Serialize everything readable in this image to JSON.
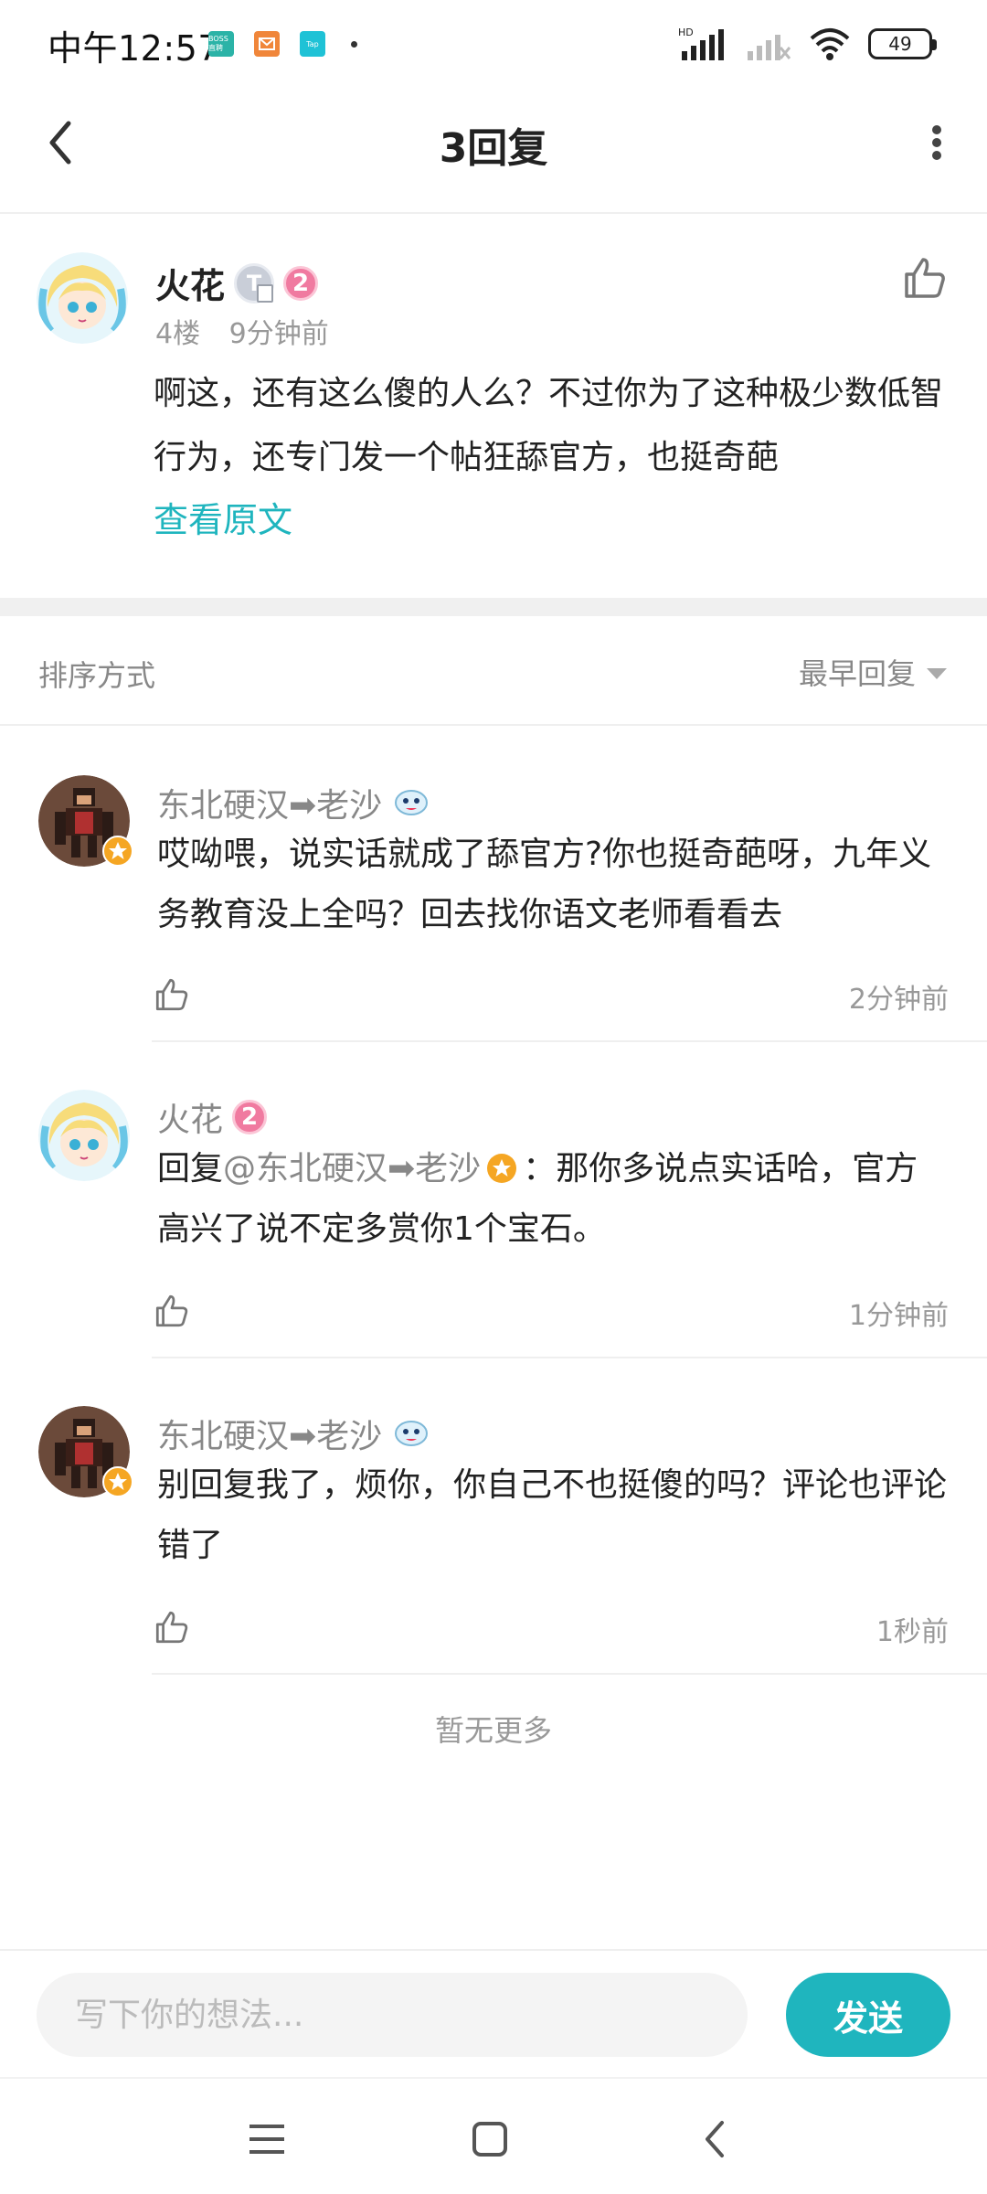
{
  "status_bar": {
    "time": "中午12:57",
    "notifications": [
      {
        "icon": "boss-app-icon",
        "label": "BOSS直聘"
      },
      {
        "icon": "mail-app-icon",
        "label": ""
      },
      {
        "icon": "tap-app-icon",
        "label": "Tap"
      }
    ],
    "hd_label": "HD",
    "battery": "49"
  },
  "header": {
    "title": "3回复",
    "back_icon": "chevron-left-icon",
    "more_icon": "more-vertical-icon"
  },
  "main_post": {
    "user_name": "火花",
    "badge_t": "T",
    "level": "2",
    "floor": "4楼",
    "time": "9分钟前",
    "content": "啊这，还有这么傻的人么？不过你为了这种极少数低智行为，还专门发一个帖狂舔官方，也挺奇葩",
    "view_original": "查看原文",
    "like_icon": "thumbs-up-icon"
  },
  "sort": {
    "label": "排序方式",
    "selected": "最早回复"
  },
  "replies": [
    {
      "user_name": "东北硬汉➡老沙",
      "content": "哎呦喂，说实话就成了舔官方?你也挺奇葩呀，九年义务教育没上全吗？回去找你语文老师看看去",
      "time": "2分钟前"
    },
    {
      "user_name": "火花",
      "level": "2",
      "reply_prefix": "回复",
      "mention": "@东北硬汉➡老沙",
      "content": "：那你多说点实话哈，官方高兴了说不定多赏你1个宝石。",
      "time": "1分钟前"
    },
    {
      "user_name": "东北硬汉➡老沙",
      "content": "别回复我了，烦你，你自己不也挺傻的吗？评论也评论错了",
      "time": "1秒前"
    }
  ],
  "no_more": "暂无更多",
  "input": {
    "placeholder": "写下你的想法...",
    "send_label": "发送"
  },
  "nav": [
    "menu-icon",
    "home-square-icon",
    "back-icon"
  ]
}
